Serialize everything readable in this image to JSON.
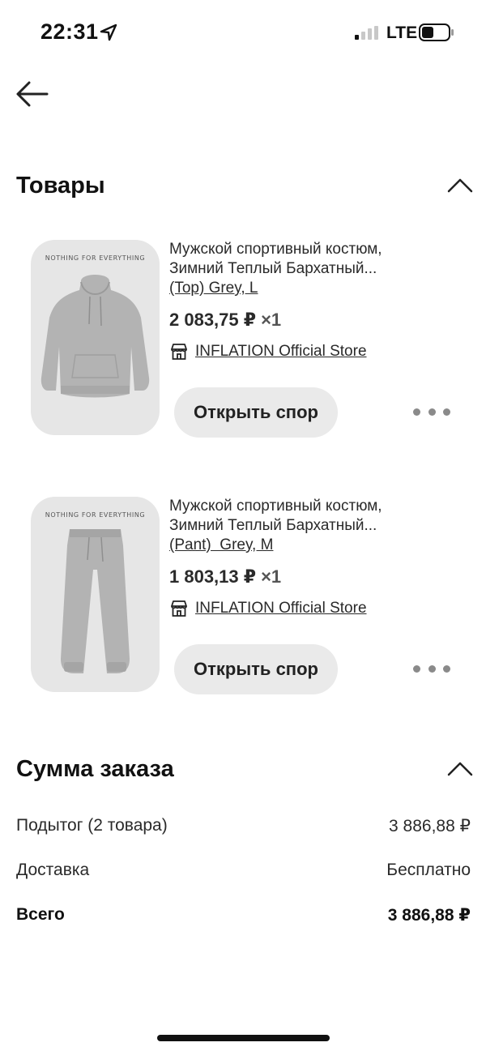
{
  "status_bar": {
    "time": "22:31",
    "network": "LTE"
  },
  "products_section": {
    "title": "Товары",
    "items": [
      {
        "title_line1": "Мужской спортивный костюм,",
        "title_line2": "Зимний Теплый Бархатный...",
        "variant": "(Top) Grey, L",
        "price": "2 083,75 ₽",
        "quantity": "×1",
        "store": "INFLATION Official Store",
        "image_brand": "NOTHING FOR EVERYTHING",
        "image_icon": "hoodie-image",
        "dispute_label": "Открыть спор"
      },
      {
        "title_line1": "Мужской спортивный костюм,",
        "title_line2": "Зимний Теплый Бархатный...",
        "variant": "(Pant)  Grey, M",
        "price": "1 803,13 ₽",
        "quantity": "×1",
        "store": "INFLATION Official Store",
        "image_brand": "NOTHING FOR EVERYTHING",
        "image_icon": "pants-image",
        "dispute_label": "Открыть спор"
      }
    ]
  },
  "summary_section": {
    "title": "Сумма заказа",
    "rows": [
      {
        "label": "Подытог (2 товара)",
        "value": "3 886,88 ₽"
      },
      {
        "label": "Доставка",
        "value": "Бесплатно"
      },
      {
        "label": "Всего",
        "value": "3 886,88 ₽"
      }
    ]
  },
  "colors": {
    "background": "#ffffff",
    "text": "#1f1f1f",
    "button_bg": "#eaeaea",
    "thumb_bg": "#e6e6e6",
    "garment": "#b3b3b3"
  }
}
